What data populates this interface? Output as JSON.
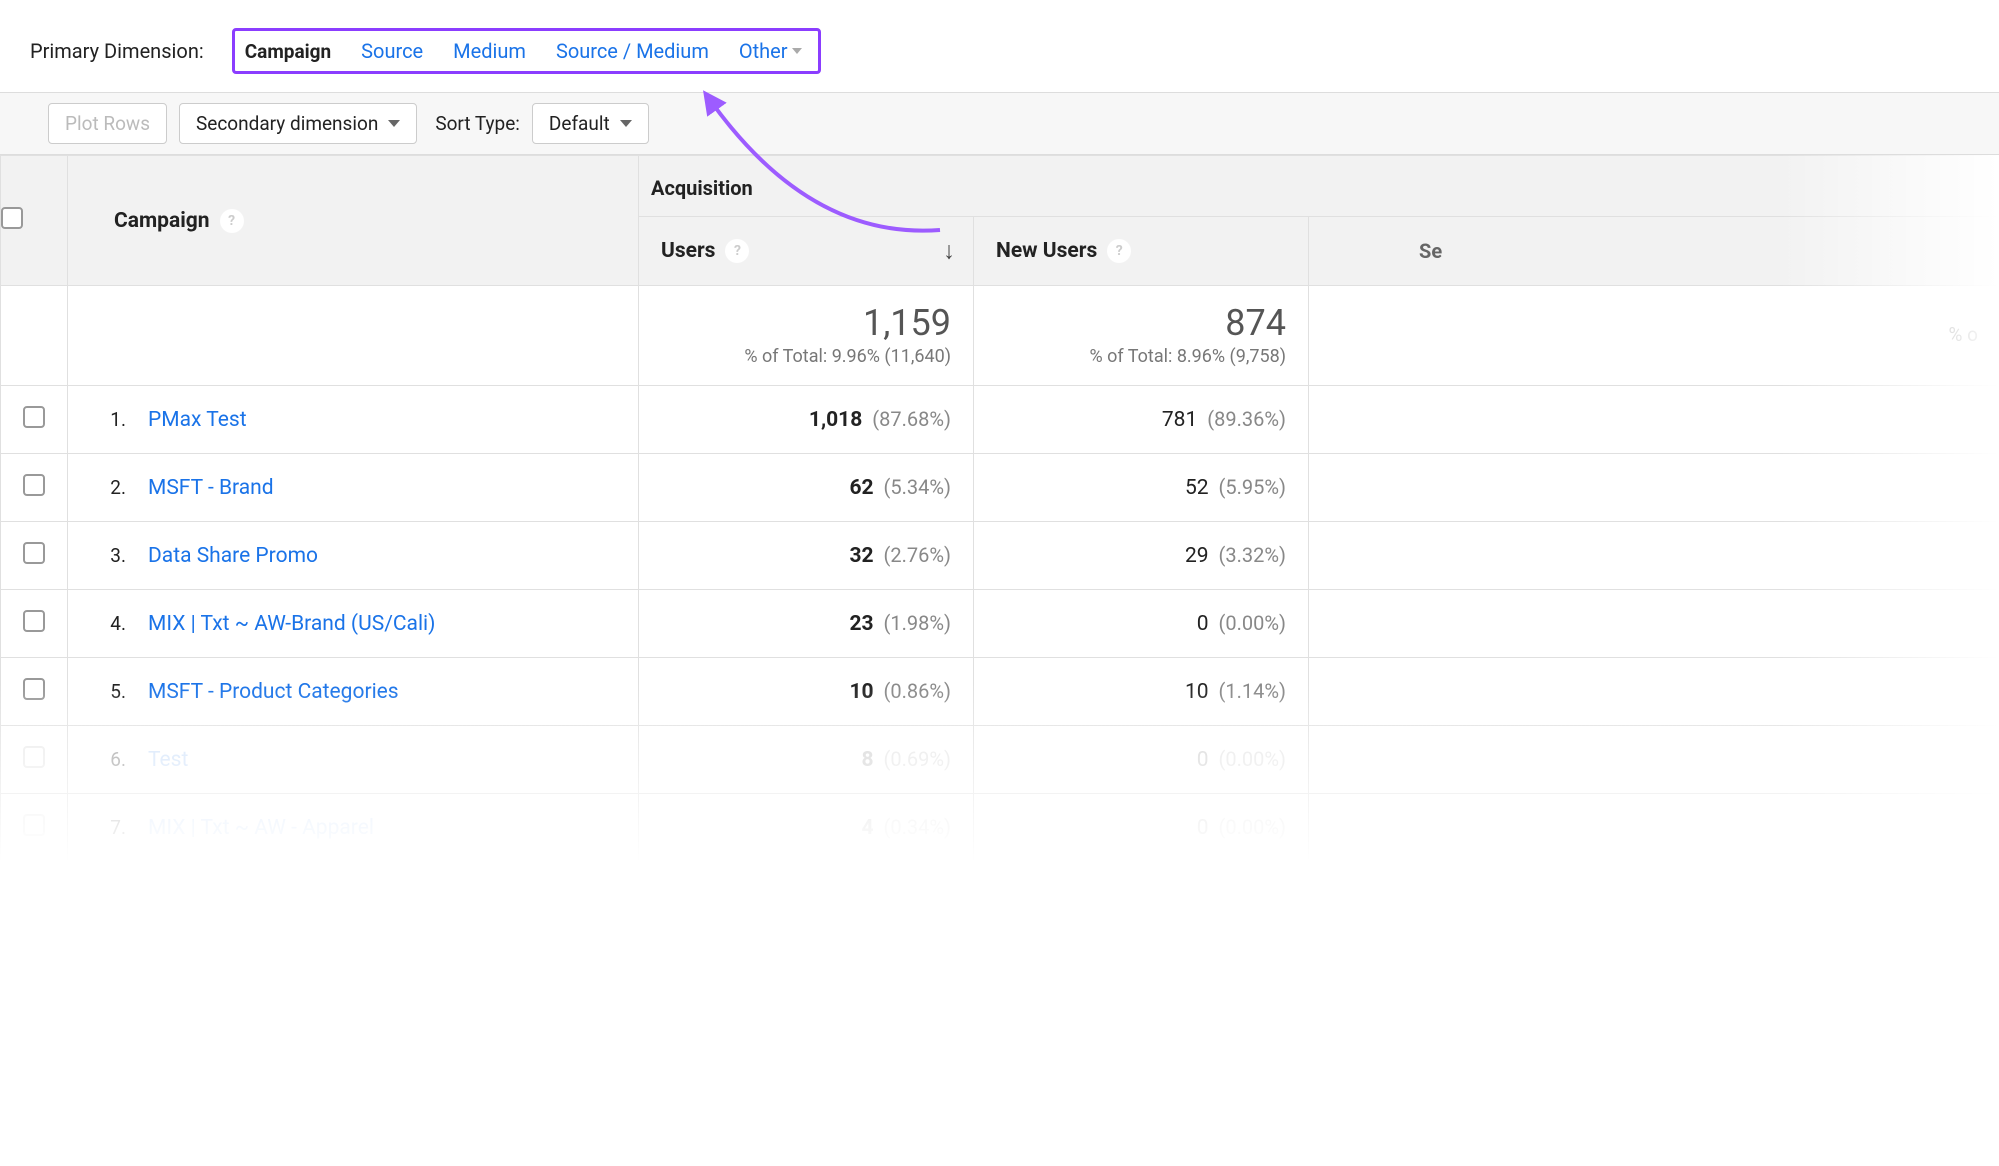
{
  "dimension": {
    "label": "Primary Dimension:",
    "tabs": [
      "Campaign",
      "Source",
      "Medium",
      "Source / Medium",
      "Other"
    ]
  },
  "toolbar": {
    "plot_rows": "Plot Rows",
    "secondary_dimension": "Secondary dimension",
    "sort_type_label": "Sort Type:",
    "sort_type_value": "Default"
  },
  "headers": {
    "campaign": "Campaign",
    "acquisition": "Acquisition",
    "users": "Users",
    "new_users": "New Users",
    "sessions_hint": "Se",
    "pct_hint": "% o"
  },
  "summary": {
    "users": {
      "value": "1,159",
      "sub": "% of Total: 9.96% (11,640)"
    },
    "new_users": {
      "value": "874",
      "sub": "% of Total: 8.96% (9,758)"
    }
  },
  "rows": [
    {
      "num": "1.",
      "name": "PMax Test",
      "users": "1,018",
      "users_pct": "(87.68%)",
      "new_users": "781",
      "new_users_pct": "(89.36%)",
      "faded": false
    },
    {
      "num": "2.",
      "name": "MSFT - Brand",
      "users": "62",
      "users_pct": "(5.34%)",
      "new_users": "52",
      "new_users_pct": "(5.95%)",
      "faded": false
    },
    {
      "num": "3.",
      "name": "Data Share Promo",
      "users": "32",
      "users_pct": "(2.76%)",
      "new_users": "29",
      "new_users_pct": "(3.32%)",
      "faded": false
    },
    {
      "num": "4.",
      "name": "MIX | Txt ~ AW-Brand (US/Cali)",
      "users": "23",
      "users_pct": "(1.98%)",
      "new_users": "0",
      "new_users_pct": "(0.00%)",
      "faded": false
    },
    {
      "num": "5.",
      "name": "MSFT - Product Categories",
      "users": "10",
      "users_pct": "(0.86%)",
      "new_users": "10",
      "new_users_pct": "(1.14%)",
      "faded": false
    },
    {
      "num": "6.",
      "name": "Test",
      "users": "8",
      "users_pct": "(0.69%)",
      "new_users": "0",
      "new_users_pct": "(0.00%)",
      "faded": true
    },
    {
      "num": "7.",
      "name": "MIX | Txt ~ AW - Apparel",
      "users": "4",
      "users_pct": "(0.34%)",
      "new_users": "0",
      "new_users_pct": "(0.00%)",
      "faded": true
    }
  ]
}
